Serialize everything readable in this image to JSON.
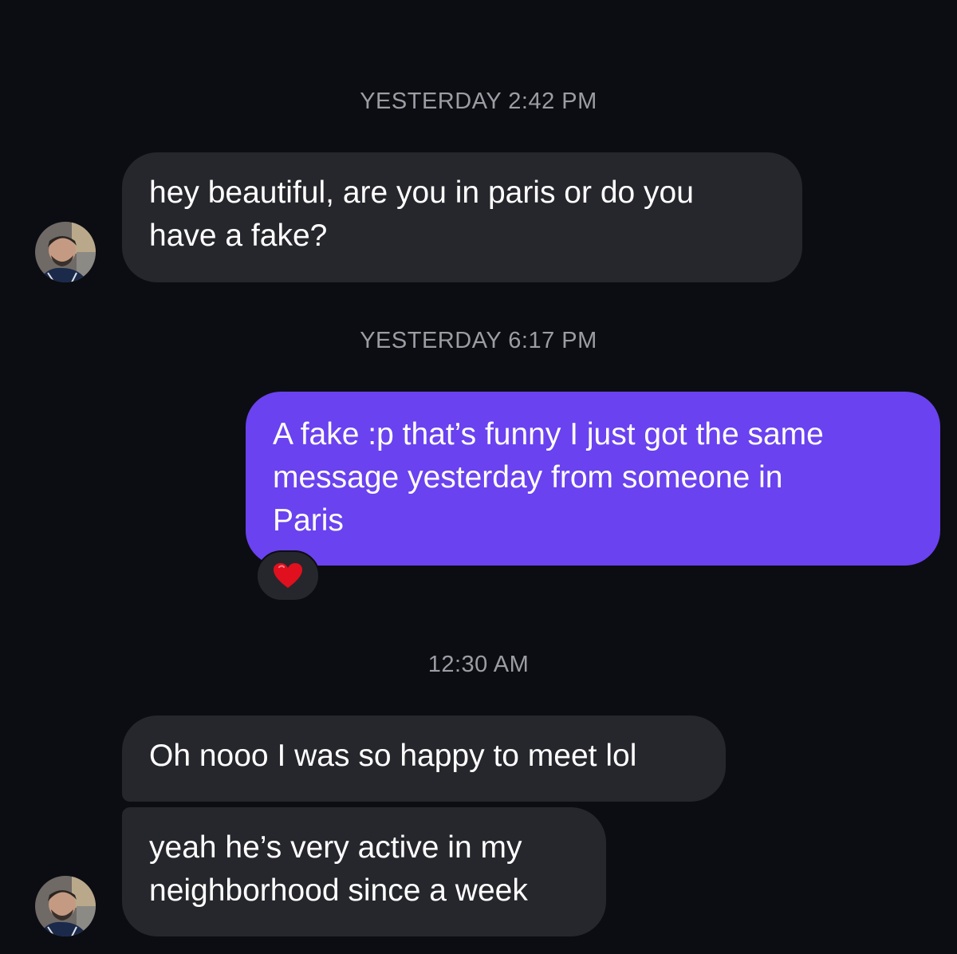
{
  "conversation": {
    "timestamps": [
      "YESTERDAY 2:42 PM",
      "YESTERDAY 6:17 PM",
      "12:30 AM"
    ],
    "messages": [
      {
        "direction": "incoming",
        "lines": [
          "hey beautiful, are you in paris or do you",
          "have a fake?"
        ]
      },
      {
        "direction": "outgoing",
        "lines": [
          "A fake :p that’s funny I just got the same",
          "message yesterday from someone in",
          "Paris"
        ],
        "reaction": "heart-icon"
      },
      {
        "direction": "incoming",
        "lines": [
          "Oh nooo I was so happy to meet lol"
        ]
      },
      {
        "direction": "incoming",
        "lines": [
          "yeah he’s very active in my",
          "neighborhood since a week"
        ]
      }
    ]
  },
  "colors": {
    "background": "#0c0d12",
    "incoming_bubble": "#26272c",
    "outgoing_bubble": "#6a42ef",
    "timestamp_text": "#9c9ca4",
    "reaction_heart": "#e0101f"
  }
}
